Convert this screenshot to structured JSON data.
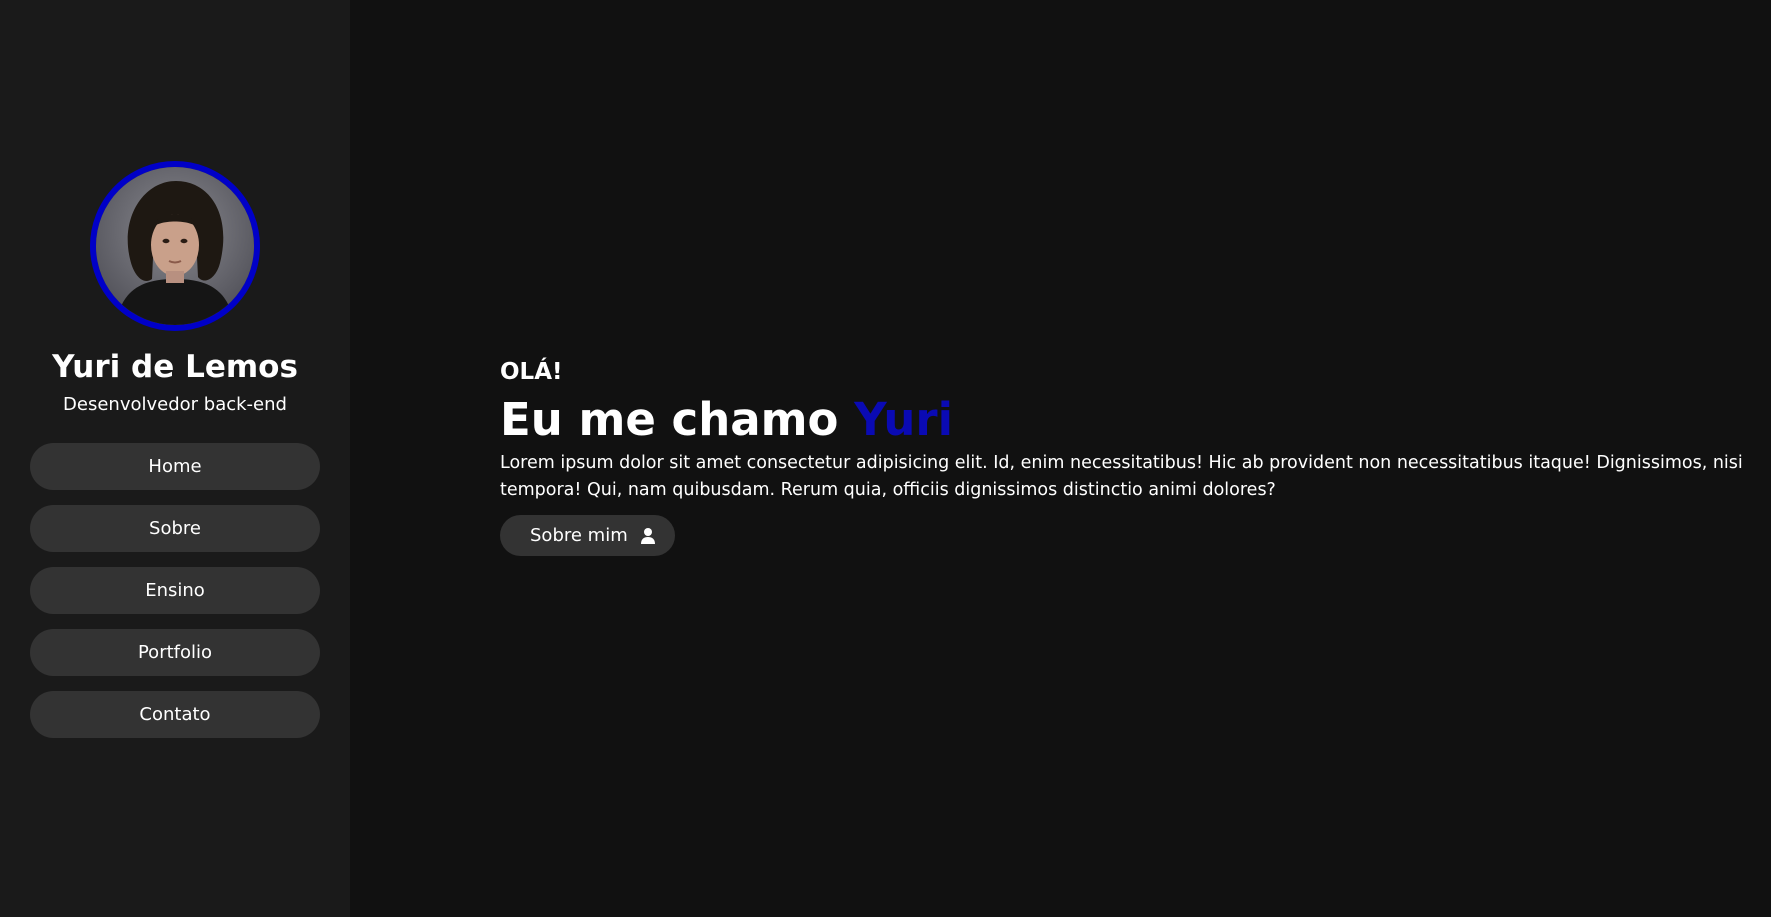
{
  "sidebar": {
    "avatar_alt": "Yuri de Lemos",
    "name": "Yuri de Lemos",
    "role": "Desenvolvedor back-end",
    "nav_items": [
      {
        "label": "Home"
      },
      {
        "label": "Sobre"
      },
      {
        "label": "Ensino"
      },
      {
        "label": "Portfolio"
      },
      {
        "label": "Contato"
      }
    ]
  },
  "hero": {
    "greeting": "OLÁ!",
    "headline_prefix": "Eu me chamo",
    "headline_accent": "Yuri",
    "intro": "Lorem ipsum dolor sit amet consectetur adipisicing elit. Id, enim necessitatibus! Hic ab provident non necessitatibus itaque! Dignissimos, nisi tempora! Qui, nam quibusdam. Rerum quia, officiis dignissimos distinctio animi dolores?",
    "cta_label": "Sobre mim",
    "cta_icon": "user-icon"
  },
  "colors": {
    "background": "#111111",
    "sidebar": "#1a1a1a",
    "button": "#333333",
    "accent": "#0a0ab4",
    "avatar_border": "#0000c8"
  }
}
